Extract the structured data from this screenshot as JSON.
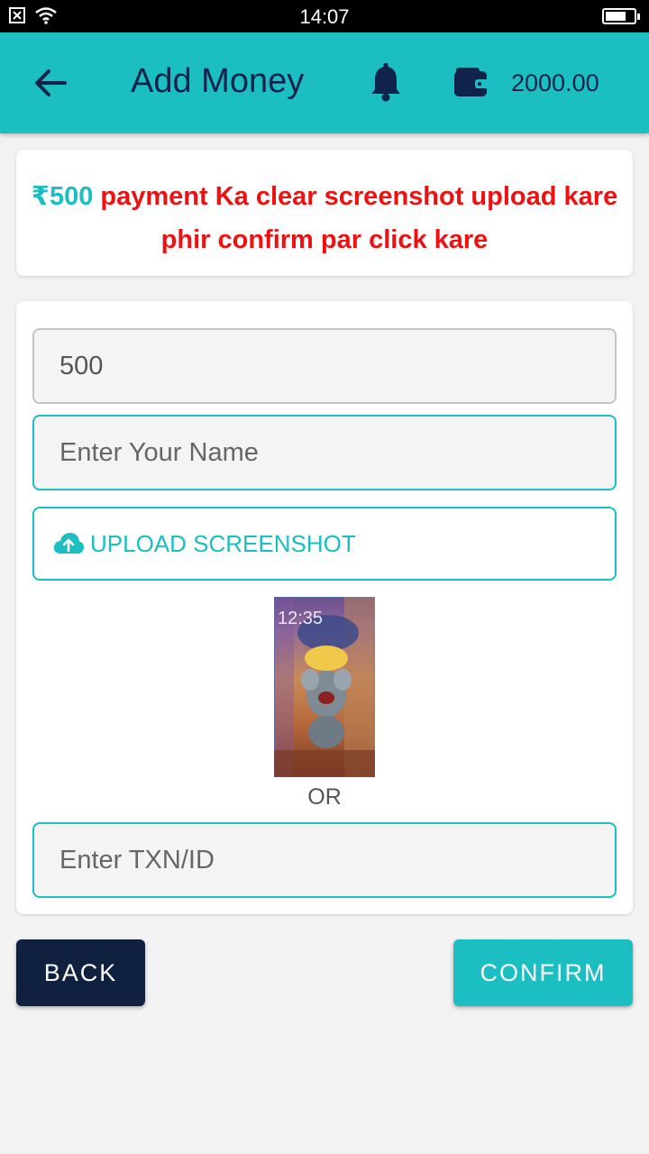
{
  "status_bar": {
    "time": "14:07"
  },
  "app_bar": {
    "title": "Add Money",
    "balance": "2000.00"
  },
  "notice": {
    "amount": "₹500",
    "message": " payment Ka clear screenshot upload kare phir confirm par click kare"
  },
  "form": {
    "amount_value": "500",
    "name_placeholder": "Enter Your Name",
    "upload_label": "UPLOAD SCREENSHOT",
    "preview_time": "12:35",
    "or_label": "OR",
    "txn_placeholder": "Enter TXN/ID"
  },
  "buttons": {
    "back": "BACK",
    "confirm": "CONFIRM"
  },
  "colors": {
    "accent": "#1bbfc2",
    "navy": "#10234a",
    "notice_red": "#ee1111"
  }
}
